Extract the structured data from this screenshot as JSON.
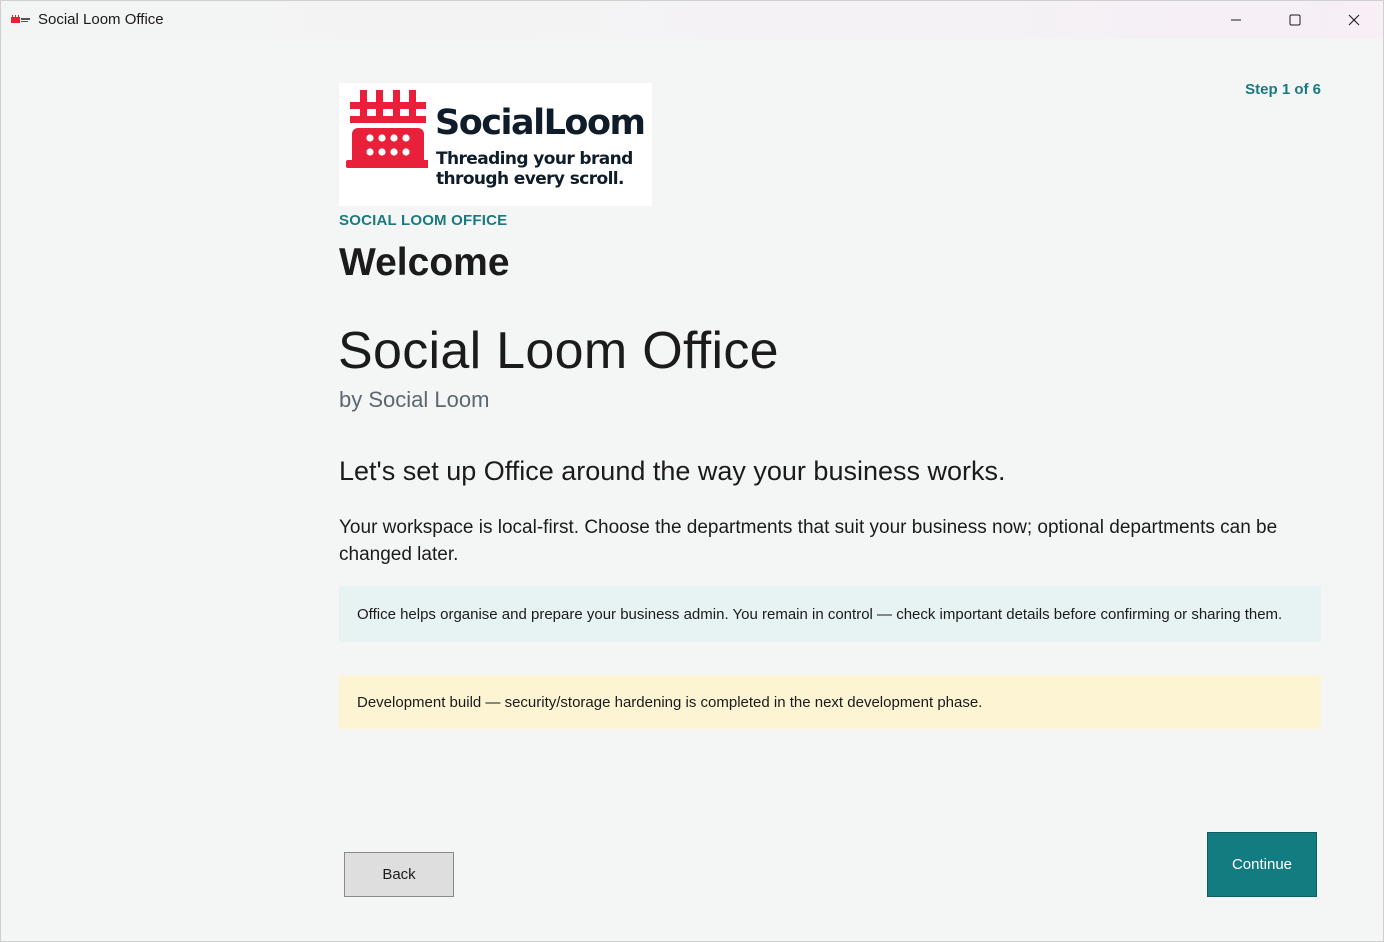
{
  "window": {
    "title": "Social Loom Office",
    "controls": {
      "minimize": "minimize-icon",
      "maximize": "maximize-icon",
      "close": "close-icon"
    }
  },
  "logo": {
    "name": "SocialLoom",
    "tagline": "Threading your brand through every scroll.",
    "brand_color": "#e8203a",
    "text_color": "#0f1d2a"
  },
  "header": {
    "step": "Step 1 of 6",
    "eyebrow": "SOCIAL LOOM OFFICE",
    "title": "Welcome"
  },
  "main": {
    "product_name": "Social Loom Office",
    "byline": "by Social Loom",
    "lead": "Let's set up Office around the way your business works.",
    "body": "Your workspace is local-first. Choose the departments that suit your business now; optional departments can be changed later.",
    "info_note": "Office helps organise and prepare your business admin. You remain in control — check important details before confirming or sharing them.",
    "warning_note": "Development build — security/storage hardening is completed in the next development phase."
  },
  "footer": {
    "back_label": "Back",
    "continue_label": "Continue"
  },
  "colors": {
    "accent": "#127c81",
    "info_bg": "#e7f2f3",
    "warning_bg": "#fdf4d3"
  }
}
